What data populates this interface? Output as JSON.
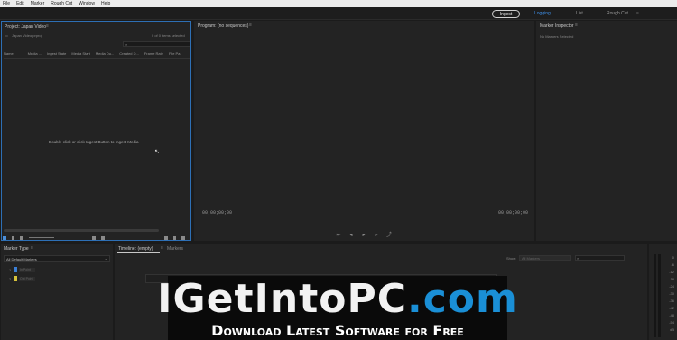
{
  "menu": [
    "File",
    "Edit",
    "Marker",
    "Rough Cut",
    "Window",
    "Help"
  ],
  "topbar": {
    "ingest_label": "Ingest",
    "tabs": [
      "Logging",
      "List",
      "Rough Cut"
    ],
    "active_tab": "Logging",
    "accent": "#3d8ee6"
  },
  "project": {
    "title": "Project: Japan Video",
    "path": "Japan Video.prproj",
    "count": "0 of 0 items selected",
    "columns": [
      "Name",
      "Media ...",
      "Ingest State",
      "Media Start",
      "Media Du...",
      "Created D...",
      "Frame Rate",
      "File Pa"
    ],
    "hint": "Double-click or click Ingest Button to Ingest Media"
  },
  "program": {
    "title": "Program: (no sequences)",
    "tc_left": "00;00;00;00",
    "tc_right": "00;00;00;00"
  },
  "inspector": {
    "title": "Marker Inspector",
    "empty": "No Markers Selected"
  },
  "marker_type": {
    "title": "Marker Type",
    "dropdown": "All Default Markers",
    "rows": [
      {
        "num": "1",
        "color": "#3b7fd6",
        "label": "In Point"
      },
      {
        "num": "2",
        "color": "#d6c23b",
        "label": "Out Point"
      }
    ]
  },
  "timeline": {
    "tab1": "Timeline: (empty)",
    "tab2": "Markers",
    "filter_label": "Show:",
    "filter_value": "All Markers"
  },
  "meter": {
    "ticks": [
      "0",
      "-6",
      "-12",
      "-18",
      "-24",
      "-30",
      "-36",
      "-42",
      "-48",
      "-54",
      "dB"
    ]
  },
  "watermark": {
    "logo_main": "IGetIntoPC",
    "logo_suffix": ".com",
    "tagline": "Download Latest Software for Free"
  }
}
